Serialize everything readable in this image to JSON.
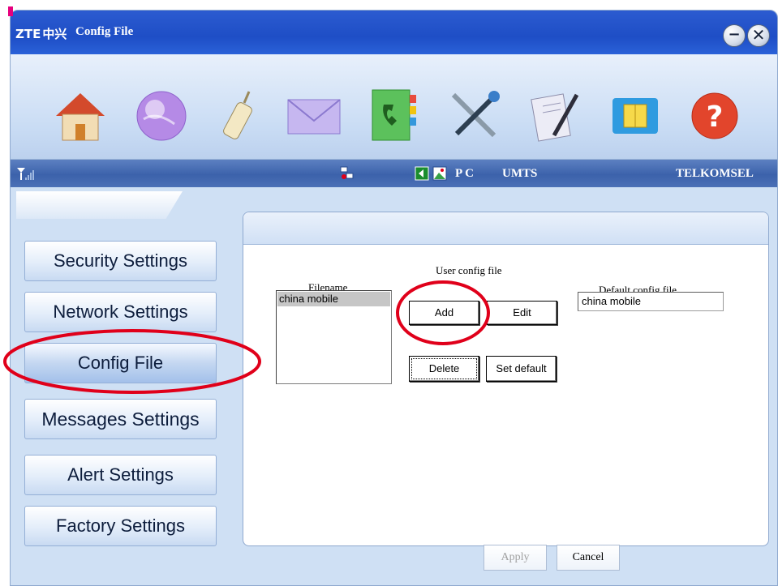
{
  "window": {
    "logo": "ZTE",
    "logo_cn": "中兴",
    "title": "Config File",
    "min_icon": "minimize-icon",
    "close_icon": "close-icon"
  },
  "toolbar": {
    "icons": [
      "home-icon",
      "internet-globe-icon",
      "phone-icon",
      "mail-envelope-icon",
      "phonebook-icon",
      "settings-tools-icon",
      "notes-pen-icon",
      "sim-card-icon",
      "help-icon"
    ]
  },
  "statusbar": {
    "signal_icon": "signal-strength-icon",
    "network_icon": "network-connection-icon",
    "pc_icons": [
      "login-icon",
      "image-icon"
    ],
    "mode": "P C",
    "network_type": "UMTS",
    "operator": "TELKOMSEL"
  },
  "sidebar": {
    "items": [
      {
        "label": "Security Settings"
      },
      {
        "label": "Network Settings"
      },
      {
        "label": "Config File"
      },
      {
        "label": "Messages Settings"
      },
      {
        "label": "Alert Settings"
      },
      {
        "label": "Factory Settings"
      }
    ],
    "active": "Config File"
  },
  "config": {
    "section_label": "User config file",
    "filename_label": "Filename",
    "files": [
      "china mobile"
    ],
    "default_label": "Default config file",
    "default_value": "china mobile",
    "add_label": "Add",
    "edit_label": "Edit",
    "delete_label": "Delete",
    "set_default_label": "Set default"
  },
  "footer": {
    "apply_label": "Apply",
    "cancel_label": "Cancel"
  },
  "colors": {
    "titlebar": "#1e4ec6",
    "statusbar": "#3c62ab",
    "annotation": "#e0001a"
  }
}
